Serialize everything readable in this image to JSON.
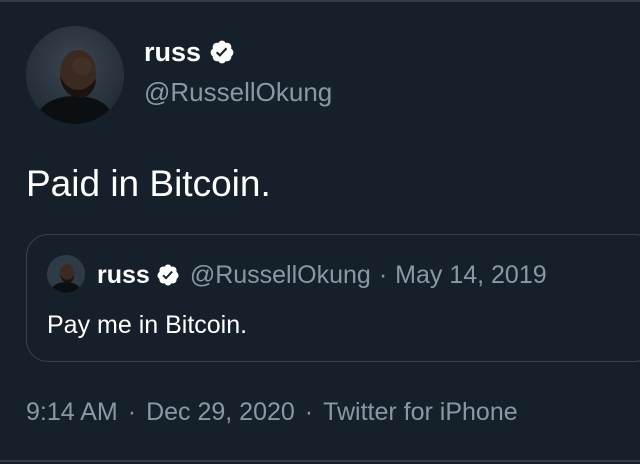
{
  "tweet": {
    "author": {
      "name": "russ",
      "handle": "@RussellOkung",
      "verified": true,
      "avatar_icon": "profile-photo"
    },
    "text": "Paid in Bitcoin.",
    "quoted": {
      "name": "russ",
      "handle": "@RussellOkung",
      "separator": "·",
      "date": "May 14, 2019",
      "text": "Pay me in Bitcoin.",
      "verified": true
    },
    "meta": {
      "time": "9:14 AM",
      "separator": "·",
      "date": "Dec 29, 2020",
      "source": "Twitter for iPhone"
    }
  },
  "colors": {
    "background": "#15202b",
    "text_primary": "#ffffff",
    "text_secondary": "#8899a6",
    "border": "#38444d",
    "verified_badge": "#ffffff"
  }
}
